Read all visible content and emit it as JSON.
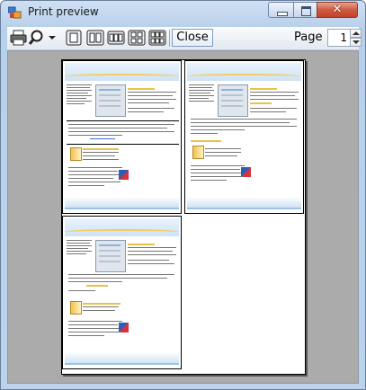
{
  "window": {
    "title": "Print preview",
    "controls": {
      "minimize": "minimize",
      "maximize": "maximize",
      "close": "✕"
    }
  },
  "toolbar": {
    "print_icon": "printer-icon",
    "zoom_icon": "magnifier-icon",
    "layouts": [
      "one-page-icon",
      "two-pages-icon",
      "three-pages-icon",
      "four-pages-icon",
      "six-pages-icon"
    ],
    "close_label": "Close",
    "page_label": "Page",
    "page_value": "1"
  },
  "preview": {
    "background": "#ababab",
    "pages_shown": 3
  }
}
